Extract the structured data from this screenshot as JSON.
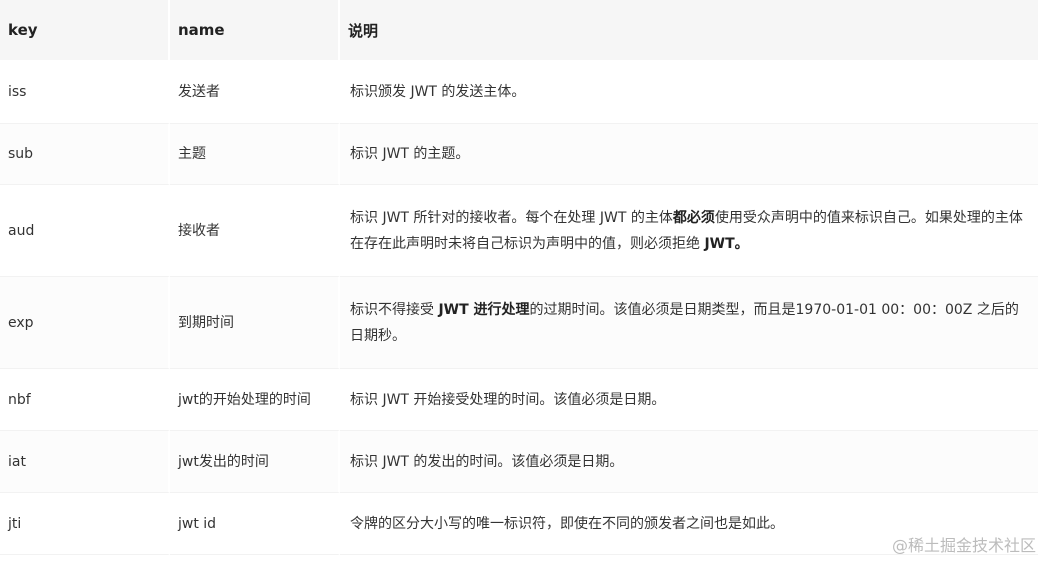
{
  "table": {
    "headers": {
      "key": "key",
      "name": "name",
      "desc": "说明"
    },
    "rows": [
      {
        "key": "iss",
        "name": "发送者",
        "desc": "标识颁发 JWT 的发送主体。"
      },
      {
        "key": "sub",
        "name": "主题",
        "desc": "标识 JWT 的主题。"
      },
      {
        "key": "aud",
        "name": "接收者",
        "desc_parts": [
          "标识 JWT 所针对的接收者。每个在处理 JWT 的主体",
          "都必须",
          "使用受众声明中的值来标识自己。如果处理的主体在存在此声明时未将自己标识为声明中的值，则必须拒绝 ",
          "JWT",
          "。"
        ]
      },
      {
        "key": "exp",
        "name": "到期时间",
        "desc_parts": [
          "标识不得接受 ",
          "JWT 进行处理",
          "的过期时间。该值必须是日期类型，而且是1970-01-01 00：00：00Z 之后的日期秒。"
        ]
      },
      {
        "key": "nbf",
        "name": "jwt的开始处理的时间",
        "desc": "标识 JWT 开始接受处理的时间。该值必须是日期。"
      },
      {
        "key": "iat",
        "name": "jwt发出的时间",
        "desc": "标识 JWT 的发出的时间。该值必须是日期。"
      },
      {
        "key": "jti",
        "name": "jwt id",
        "desc": "令牌的区分大小写的唯一标识符，即使在不同的颁发者之间也是如此。"
      }
    ]
  },
  "watermark": "@稀土掘金技术社区"
}
